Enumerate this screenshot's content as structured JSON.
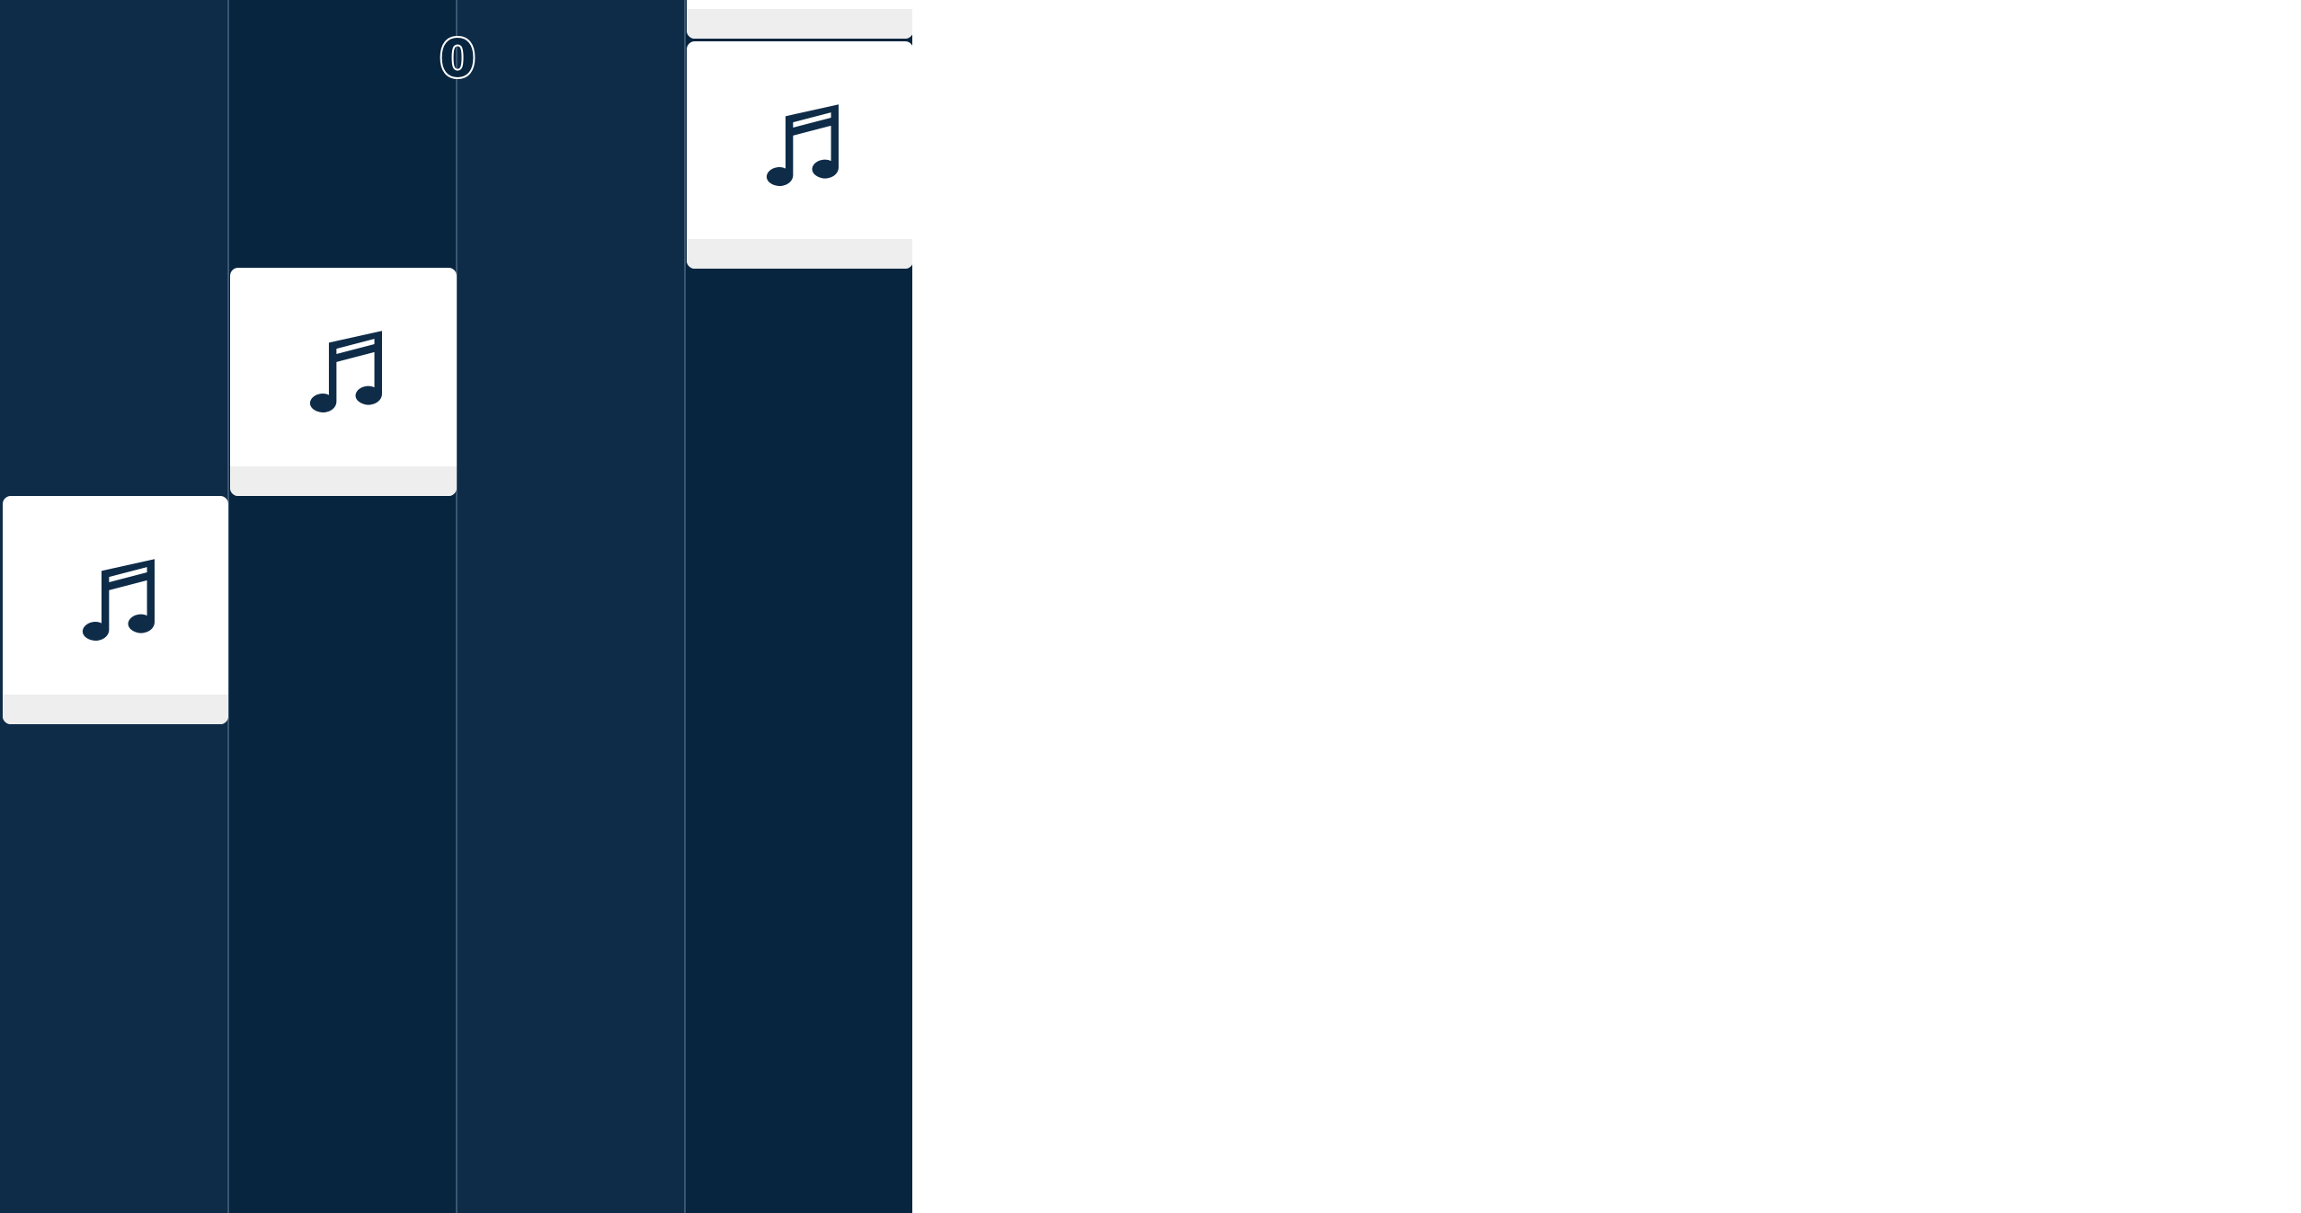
{
  "game": {
    "score": "0",
    "lane_count": 4,
    "colors": {
      "lane_light": "#0e2c48",
      "lane_dark": "#08253f",
      "lane_divider": "#3b5670",
      "tile_face": "#ffffff",
      "tile_base": "#eeeeee",
      "note_icon": "#0e2c48",
      "outside_background": "#ffffff"
    },
    "tiles": [
      {
        "lane": 4,
        "icon": "music-note-icon",
        "state": "partially-visible"
      },
      {
        "lane": 4,
        "icon": "music-note-icon"
      },
      {
        "lane": 2,
        "icon": "music-note-icon"
      },
      {
        "lane": 1,
        "icon": "music-note-icon"
      }
    ]
  }
}
